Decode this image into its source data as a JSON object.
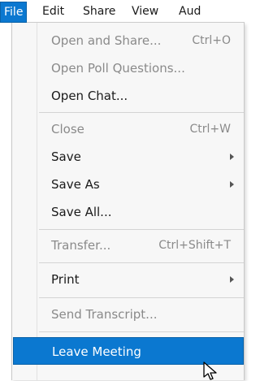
{
  "menubar": {
    "items": [
      {
        "label": "File"
      },
      {
        "label": "Edit"
      },
      {
        "label": "Share"
      },
      {
        "label": "View"
      },
      {
        "label": "Aud"
      }
    ]
  },
  "file_menu": {
    "open_and_share": {
      "label": "Open and Share...",
      "shortcut": "Ctrl+O"
    },
    "open_poll_questions": {
      "label": "Open Poll Questions..."
    },
    "open_chat": {
      "label": "Open Chat..."
    },
    "close": {
      "label": "Close",
      "shortcut": "Ctrl+W"
    },
    "save": {
      "label": "Save"
    },
    "save_as": {
      "label": "Save As"
    },
    "save_all": {
      "label": "Save All..."
    },
    "transfer": {
      "label": "Transfer...",
      "shortcut": "Ctrl+Shift+T"
    },
    "print": {
      "label": "Print"
    },
    "send_transcript": {
      "label": "Send Transcript..."
    },
    "leave_meeting": {
      "label": "Leave Meeting"
    }
  },
  "icons": {
    "submenu": "chevron-right-icon",
    "cursor": "mouse-pointer-icon"
  },
  "colors": {
    "highlight": "#0b78d0",
    "disabled_text": "#8a8a8a",
    "menu_bg": "#f7f7f7"
  }
}
